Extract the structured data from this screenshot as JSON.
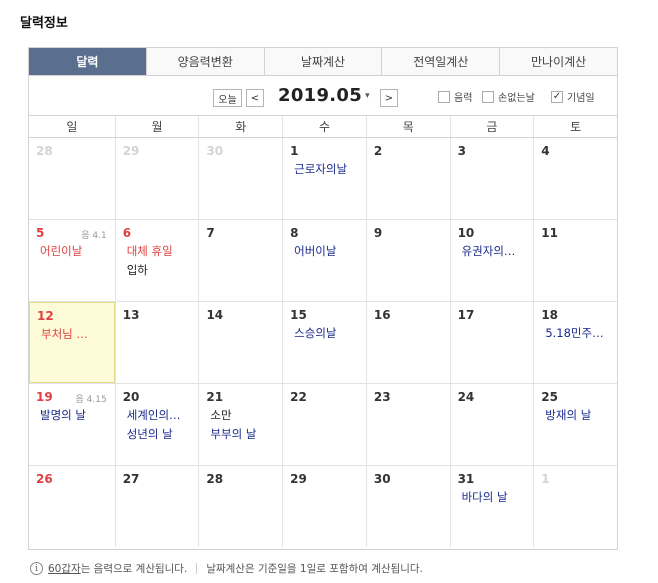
{
  "title": "달력정보",
  "tabs": [
    "달력",
    "양음력변환",
    "날짜계산",
    "전역일계산",
    "만나이계산"
  ],
  "toolbar": {
    "today": "오늘",
    "prev": "<",
    "next": ">",
    "month": "2019.05",
    "caret": "▾",
    "opt_lunar": "음력",
    "opt_sonless": "손없는날",
    "opt_anniv": "기념일",
    "check_mark": "✓"
  },
  "weekdays": [
    "일",
    "월",
    "화",
    "수",
    "목",
    "금",
    "토"
  ],
  "weeks": [
    [
      {
        "d": "28",
        "other": true
      },
      {
        "d": "29",
        "other": true
      },
      {
        "d": "30",
        "other": true
      },
      {
        "d": "1",
        "events": [
          {
            "t": "근로자의날",
            "c": "memo"
          }
        ]
      },
      {
        "d": "2"
      },
      {
        "d": "3"
      },
      {
        "d": "4"
      }
    ],
    [
      {
        "d": "5",
        "sun": true,
        "lunar": "음 4.1",
        "events": [
          {
            "t": "어린이날",
            "c": "holi"
          }
        ]
      },
      {
        "d": "6",
        "sun": true,
        "events": [
          {
            "t": "대체 휴일",
            "c": "holi"
          },
          {
            "t": "입하",
            "c": "plain"
          }
        ]
      },
      {
        "d": "7"
      },
      {
        "d": "8",
        "events": [
          {
            "t": "어버이날",
            "c": "memo"
          }
        ]
      },
      {
        "d": "9"
      },
      {
        "d": "10",
        "events": [
          {
            "t": "유권자의…",
            "c": "memo"
          }
        ]
      },
      {
        "d": "11"
      }
    ],
    [
      {
        "d": "12",
        "sun": true,
        "today": true,
        "events": [
          {
            "t": "부처님 …",
            "c": "holi"
          }
        ]
      },
      {
        "d": "13"
      },
      {
        "d": "14"
      },
      {
        "d": "15",
        "events": [
          {
            "t": "스승의날",
            "c": "memo"
          }
        ]
      },
      {
        "d": "16"
      },
      {
        "d": "17"
      },
      {
        "d": "18",
        "events": [
          {
            "t": "5.18민주…",
            "c": "memo"
          }
        ]
      }
    ],
    [
      {
        "d": "19",
        "sun": true,
        "lunar": "음 4.15",
        "events": [
          {
            "t": "발명의 날",
            "c": "memo"
          }
        ]
      },
      {
        "d": "20",
        "events": [
          {
            "t": "세계인의…",
            "c": "memo"
          },
          {
            "t": "성년의 날",
            "c": "memo"
          }
        ]
      },
      {
        "d": "21",
        "events": [
          {
            "t": "소만",
            "c": "plain"
          },
          {
            "t": "부부의 날",
            "c": "memo"
          }
        ]
      },
      {
        "d": "22"
      },
      {
        "d": "23"
      },
      {
        "d": "24"
      },
      {
        "d": "25",
        "events": [
          {
            "t": "방재의 날",
            "c": "memo"
          }
        ]
      }
    ],
    [
      {
        "d": "26",
        "sun": true
      },
      {
        "d": "27"
      },
      {
        "d": "28"
      },
      {
        "d": "29"
      },
      {
        "d": "30"
      },
      {
        "d": "31",
        "events": [
          {
            "t": "바다의 날",
            "c": "memo"
          }
        ]
      },
      {
        "d": "1",
        "other": true
      }
    ]
  ],
  "footer": {
    "info_icon": "i",
    "link": "60갑자",
    "note1": "는 음력으로 계산됩니다.",
    "note2": "날짜계산은 기준일을 1일로 포함하여 계산됩니다."
  },
  "colors": {
    "tab_active": "#5a6f8e",
    "holiday": "#e04040",
    "memorial": "#1a2a8c",
    "today_bg": "#fdfbd8"
  }
}
